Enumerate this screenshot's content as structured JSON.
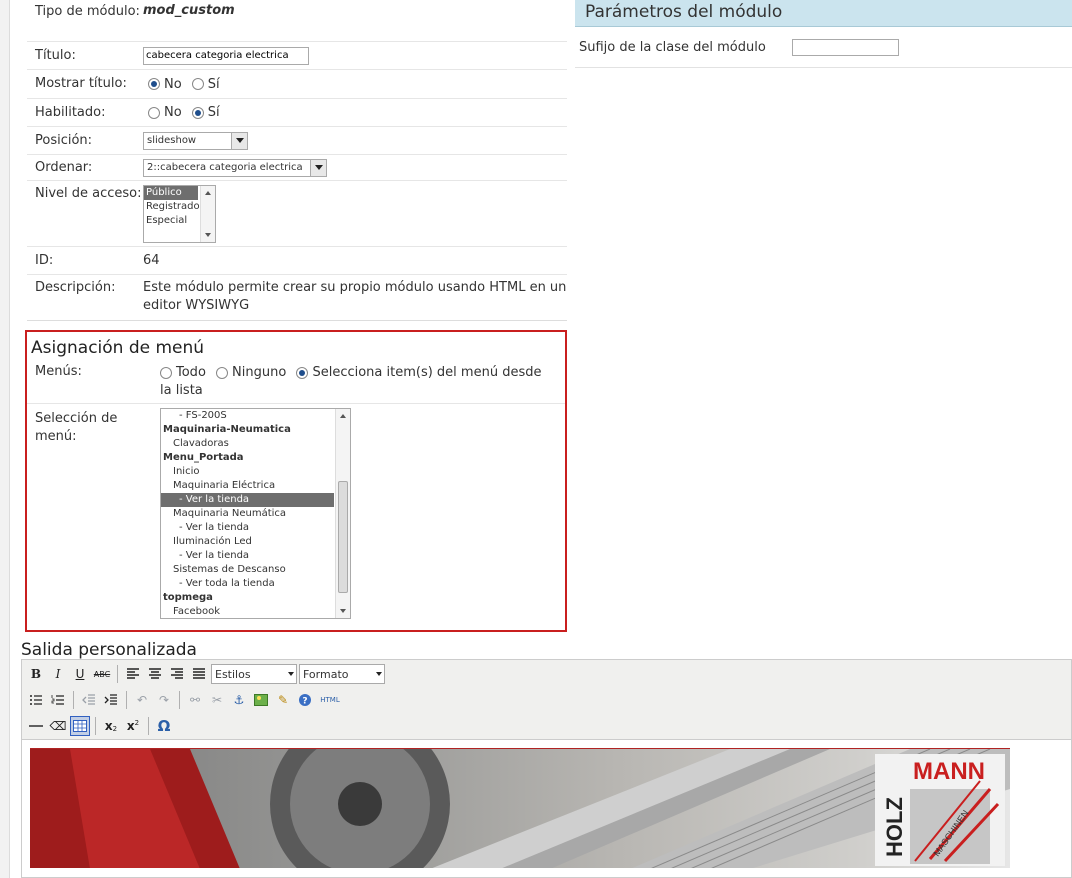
{
  "module_form": {
    "tipo_label": "Tipo de módulo:",
    "tipo_value": "mod_custom",
    "titulo_label": "Título:",
    "titulo_value": "cabecera categoria electrica",
    "mostrar_label": "Mostrar título:",
    "mostrar_no": "No",
    "mostrar_si": "Sí",
    "habilitado_label": "Habilitado:",
    "habilitado_no": "No",
    "habilitado_si": "Sí",
    "posicion_label": "Posición:",
    "posicion_value": "slideshow",
    "ordenar_label": "Ordenar:",
    "ordenar_value": "2::cabecera categoria electrica",
    "nivel_label": "Nivel de acceso:",
    "nivel_options": [
      "Público",
      "Registrado",
      "Especial"
    ],
    "id_label": "ID:",
    "id_value": "64",
    "descripcion_label": "Descripción:",
    "descripcion_value": "Este módulo permite crear su propio módulo usando HTML en un editor WYSIWYG"
  },
  "menu_assignment": {
    "title": "Asignación de menú",
    "menus_label": "Menús:",
    "opt_todo": "Todo",
    "opt_ninguno": "Ninguno",
    "opt_selecciona": "Selecciona item(s) del menú desde la lista",
    "seleccion_label": "Selección de menú:",
    "items": [
      {
        "text": "- FS-200S"
      },
      {
        "text": "Maquinaria-Neumatica"
      },
      {
        "text": "Clavadoras"
      },
      {
        "text": "Menu_Portada"
      },
      {
        "text": "Inicio"
      },
      {
        "text": "Maquinaria Eléctrica"
      },
      {
        "text": "- Ver la tienda"
      },
      {
        "text": "Maquinaria Neumática"
      },
      {
        "text": "- Ver la tienda"
      },
      {
        "text": "Iluminación Led"
      },
      {
        "text": "- Ver la tienda"
      },
      {
        "text": "Sistemas de Descanso"
      },
      {
        "text": "- Ver toda la tienda"
      },
      {
        "text": "topmega"
      },
      {
        "text": "Facebook"
      }
    ]
  },
  "params": {
    "title": "Parámetros del módulo",
    "sufijo_label": "Sufijo de la clase del módulo",
    "sufijo_value": ""
  },
  "custom_output": {
    "title": "Salida personalizada",
    "styles_select": "Estilos",
    "format_select": "Formato",
    "html_btn": "HTML",
    "banner_brand_top": "MANN",
    "banner_brand_side": "HOLZ",
    "banner_brand_sub": "MASCHINEN"
  },
  "colors": {
    "accent_red": "#c91f1f",
    "panel_blue": "#cbe4ee",
    "selection_gray": "#6e6e6e"
  }
}
